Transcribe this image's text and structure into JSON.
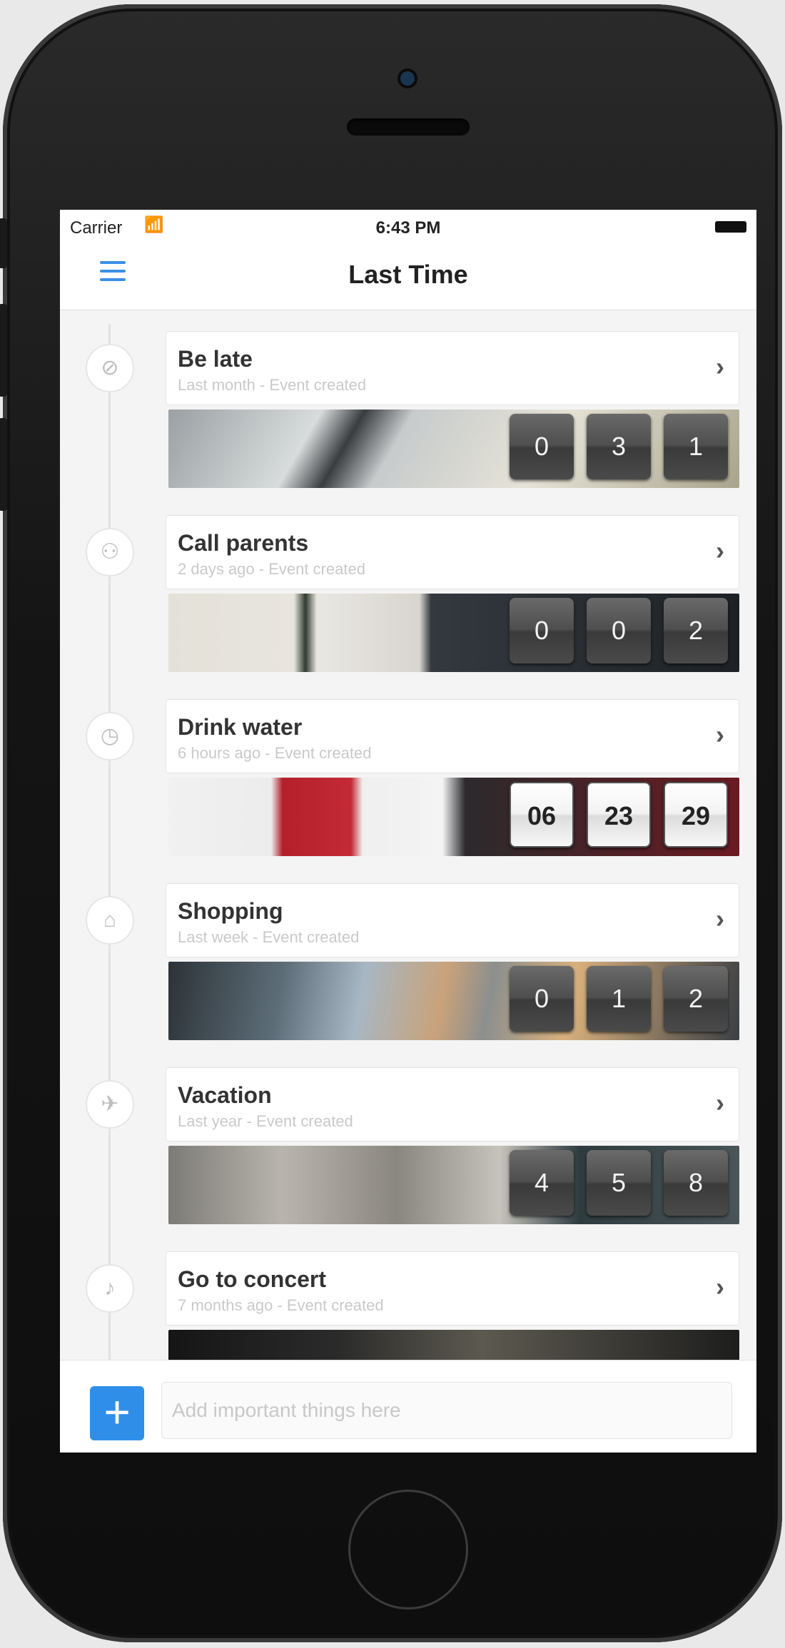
{
  "status": {
    "carrier": "Carrier",
    "time": "6:43 PM"
  },
  "app": {
    "title": "Last Time"
  },
  "events": [
    {
      "name": "Be late",
      "sub": "Last month - Event created",
      "icon": "ban-icon",
      "glyph": "⊘",
      "digits": [
        "0",
        "3",
        "1"
      ],
      "style": "dark"
    },
    {
      "name": "Call parents",
      "sub": "2 days ago - Event created",
      "icon": "people-icon",
      "glyph": "⚇",
      "digits": [
        "0",
        "0",
        "2"
      ],
      "style": "dark"
    },
    {
      "name": "Drink water",
      "sub": "6 hours ago - Event created",
      "icon": "clock-icon",
      "glyph": "◷",
      "digits": [
        "06",
        "23",
        "29"
      ],
      "style": "light"
    },
    {
      "name": "Shopping",
      "sub": "Last week - Event created",
      "icon": "hanger-icon",
      "glyph": "⌂",
      "digits": [
        "0",
        "1",
        "2"
      ],
      "style": "dark"
    },
    {
      "name": "Vacation",
      "sub": "Last year - Event created",
      "icon": "airplane-icon",
      "glyph": "✈",
      "digits": [
        "4",
        "5",
        "8"
      ],
      "style": "dark"
    },
    {
      "name": "Go to concert",
      "sub": "7 months ago - Event created",
      "icon": "music-note-icon",
      "glyph": "♪",
      "digits": [],
      "style": "dark"
    }
  ],
  "bottom": {
    "add_label": "+",
    "placeholder": "Add important things here"
  },
  "colors": {
    "accent": "#2f8fe8",
    "menu": "#3b8fe6"
  }
}
